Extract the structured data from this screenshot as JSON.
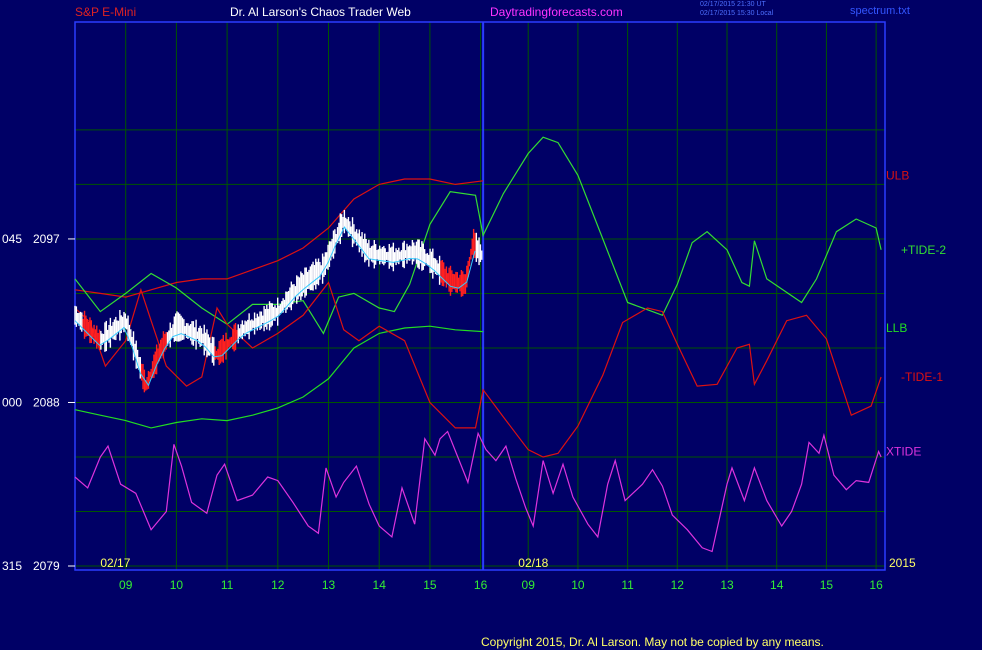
{
  "header": {
    "symbol": "S&P E-Mini",
    "title": "Dr. Al Larson's Chaos Trader Web",
    "site": "Daytradingforecasts.com",
    "stamp_ut": "02/17/2015 21:30 UT",
    "stamp_local": "02/17/2015 15:30 Local",
    "file": "spectrum.txt"
  },
  "copyright": "Copyright 2015, Dr. Al Larson. May not be copied by any means.",
  "colors": {
    "background": "#000066",
    "plot_border": "#2a3cff",
    "grid": "#005500",
    "ulb": "#dd1111",
    "llb": "#22dd22",
    "tide_plus": "#33dd33",
    "tide_minus": "#dd1111",
    "xtide": "#dd33dd",
    "ma": "#33ccff",
    "price_up": "#ffffff",
    "price_down": "#ff2020",
    "title_red": "#dd2222",
    "title_white": "#ffffff",
    "title_magenta": "#ff33ff",
    "label_yellow": "#ffff66",
    "label_green": "#33ee33"
  },
  "chart_data": {
    "type": "line",
    "ylabels": [
      {
        "left": "045",
        "price": "2097",
        "value": 2097
      },
      {
        "left": "000",
        "price": "2088",
        "value": 2088
      },
      {
        "left": "315",
        "price": "2079",
        "value": 2079
      }
    ],
    "ylim": [
      2079,
      2104
    ],
    "xlim": [
      8.0,
      32.1
    ],
    "date_labels": [
      {
        "text": "02/17",
        "x": 8.5
      },
      {
        "text": "02/18",
        "x": 16.8
      }
    ],
    "year_label": "2015",
    "xticks": [
      {
        "label": "09",
        "x": 9
      },
      {
        "label": "10",
        "x": 10
      },
      {
        "label": "11",
        "x": 11
      },
      {
        "label": "12",
        "x": 12
      },
      {
        "label": "13",
        "x": 13
      },
      {
        "label": "14",
        "x": 14
      },
      {
        "label": "15",
        "x": 15
      },
      {
        "label": "16",
        "x": 16
      },
      {
        "label": "09",
        "x": 17
      },
      {
        "label": "10",
        "x": 18
      },
      {
        "label": "11",
        "x": 19
      },
      {
        "label": "12",
        "x": 20
      },
      {
        "label": "13",
        "x": 21
      },
      {
        "label": "14",
        "x": 22
      },
      {
        "label": "15",
        "x": 23
      },
      {
        "label": "16",
        "x": 24
      }
    ],
    "now_x": 16.05,
    "series": [
      {
        "name": "ULB",
        "label_value": 2100.5,
        "points": [
          [
            8.0,
            2094.2
          ],
          [
            8.5,
            2094.0
          ],
          [
            9.0,
            2093.8
          ],
          [
            9.5,
            2094.2
          ],
          [
            10.0,
            2094.6
          ],
          [
            10.5,
            2094.8
          ],
          [
            11.0,
            2094.8
          ],
          [
            11.5,
            2095.3
          ],
          [
            12.0,
            2095.8
          ],
          [
            12.5,
            2096.5
          ],
          [
            13.0,
            2097.6
          ],
          [
            13.5,
            2099.2
          ],
          [
            14.0,
            2100.0
          ],
          [
            14.5,
            2100.3
          ],
          [
            15.0,
            2100.3
          ],
          [
            15.5,
            2100.0
          ],
          [
            16.05,
            2100.2
          ]
        ]
      },
      {
        "name": "LLB",
        "label_value": 2092.1,
        "points": [
          [
            8.0,
            2087.6
          ],
          [
            8.5,
            2087.3
          ],
          [
            9.0,
            2087.0
          ],
          [
            9.5,
            2086.6
          ],
          [
            10.0,
            2086.9
          ],
          [
            10.5,
            2087.1
          ],
          [
            11.0,
            2087.0
          ],
          [
            11.5,
            2087.3
          ],
          [
            12.0,
            2087.7
          ],
          [
            12.5,
            2088.3
          ],
          [
            13.0,
            2089.3
          ],
          [
            13.5,
            2091.0
          ],
          [
            14.0,
            2091.8
          ],
          [
            14.5,
            2092.1
          ],
          [
            15.0,
            2092.2
          ],
          [
            15.5,
            2092.0
          ],
          [
            16.05,
            2091.9
          ]
        ]
      },
      {
        "name": "+TIDE-2",
        "label_value": 2096.4,
        "points": [
          [
            8.0,
            2094.8
          ],
          [
            8.5,
            2093.0
          ],
          [
            9.0,
            2094.0
          ],
          [
            9.5,
            2095.1
          ],
          [
            10.0,
            2094.3
          ],
          [
            10.5,
            2093.2
          ],
          [
            11.0,
            2092.3
          ],
          [
            11.5,
            2093.4
          ],
          [
            12.0,
            2093.4
          ],
          [
            12.5,
            2093.6
          ],
          [
            12.9,
            2091.8
          ],
          [
            13.2,
            2093.8
          ],
          [
            13.5,
            2094.0
          ],
          [
            14.0,
            2093.2
          ],
          [
            14.3,
            2093.0
          ],
          [
            14.6,
            2094.5
          ],
          [
            15.0,
            2097.8
          ],
          [
            15.4,
            2099.6
          ],
          [
            15.9,
            2099.4
          ],
          [
            16.05,
            2097.2
          ],
          [
            16.5,
            2099.5
          ],
          [
            17.0,
            2101.7
          ],
          [
            17.3,
            2102.6
          ],
          [
            17.6,
            2102.3
          ],
          [
            18.0,
            2100.5
          ],
          [
            18.5,
            2097.0
          ],
          [
            19.0,
            2093.5
          ],
          [
            19.5,
            2093.0
          ],
          [
            19.7,
            2092.8
          ],
          [
            20.0,
            2094.5
          ],
          [
            20.3,
            2096.8
          ],
          [
            20.6,
            2097.4
          ],
          [
            21.0,
            2096.4
          ],
          [
            21.3,
            2094.6
          ],
          [
            21.45,
            2094.4
          ],
          [
            21.55,
            2096.9
          ],
          [
            21.8,
            2094.8
          ],
          [
            22.5,
            2093.5
          ],
          [
            22.8,
            2094.8
          ],
          [
            23.2,
            2097.4
          ],
          [
            23.6,
            2098.1
          ],
          [
            24.0,
            2097.6
          ],
          [
            24.1,
            2096.4
          ]
        ]
      },
      {
        "name": "-TIDE-1",
        "label_value": 2089.4,
        "points": [
          [
            8.0,
            2093.2
          ],
          [
            8.3,
            2092.4
          ],
          [
            8.6,
            2090.0
          ],
          [
            9.0,
            2091.4
          ],
          [
            9.3,
            2094.2
          ],
          [
            9.5,
            2092.5
          ],
          [
            9.8,
            2090.0
          ],
          [
            10.2,
            2088.9
          ],
          [
            10.5,
            2089.4
          ],
          [
            10.8,
            2093.2
          ],
          [
            11.0,
            2092.3
          ],
          [
            11.5,
            2091.0
          ],
          [
            12.0,
            2091.8
          ],
          [
            12.5,
            2092.8
          ],
          [
            13.0,
            2094.6
          ],
          [
            13.3,
            2092.0
          ],
          [
            13.6,
            2091.4
          ],
          [
            14.0,
            2092.2
          ],
          [
            14.5,
            2091.4
          ],
          [
            15.0,
            2088.0
          ],
          [
            15.5,
            2086.6
          ],
          [
            15.9,
            2086.6
          ],
          [
            16.05,
            2088.7
          ],
          [
            16.5,
            2087.2
          ],
          [
            17.0,
            2085.4
          ],
          [
            17.3,
            2085.0
          ],
          [
            17.6,
            2085.2
          ],
          [
            18.0,
            2086.7
          ],
          [
            18.5,
            2089.5
          ],
          [
            18.9,
            2092.4
          ],
          [
            19.4,
            2093.2
          ],
          [
            19.7,
            2093.0
          ],
          [
            20.0,
            2091.2
          ],
          [
            20.4,
            2088.9
          ],
          [
            20.8,
            2089.0
          ],
          [
            21.2,
            2091.0
          ],
          [
            21.45,
            2091.2
          ],
          [
            21.55,
            2089.0
          ],
          [
            21.8,
            2090.3
          ],
          [
            22.2,
            2092.5
          ],
          [
            22.6,
            2092.8
          ],
          [
            23.0,
            2091.5
          ],
          [
            23.5,
            2087.3
          ],
          [
            23.9,
            2087.8
          ],
          [
            24.1,
            2089.4
          ]
        ]
      },
      {
        "name": "XTIDE",
        "label_value": 2085.3,
        "points": [
          [
            8.0,
            2083.9
          ],
          [
            8.25,
            2083.3
          ],
          [
            8.5,
            2085.0
          ],
          [
            8.65,
            2085.6
          ],
          [
            8.9,
            2083.5
          ],
          [
            9.2,
            2083.0
          ],
          [
            9.5,
            2081.0
          ],
          [
            9.8,
            2082.0
          ],
          [
            9.95,
            2085.7
          ],
          [
            10.1,
            2084.5
          ],
          [
            10.3,
            2082.5
          ],
          [
            10.6,
            2081.9
          ],
          [
            10.8,
            2084.0
          ],
          [
            10.95,
            2084.6
          ],
          [
            11.2,
            2082.6
          ],
          [
            11.5,
            2082.9
          ],
          [
            11.8,
            2083.9
          ],
          [
            12.0,
            2083.7
          ],
          [
            12.3,
            2082.5
          ],
          [
            12.6,
            2081.2
          ],
          [
            12.8,
            2080.8
          ],
          [
            12.95,
            2084.4
          ],
          [
            13.15,
            2082.8
          ],
          [
            13.3,
            2083.6
          ],
          [
            13.55,
            2084.5
          ],
          [
            13.8,
            2082.4
          ],
          [
            14.0,
            2081.2
          ],
          [
            14.25,
            2080.6
          ],
          [
            14.45,
            2083.3
          ],
          [
            14.7,
            2081.3
          ],
          [
            14.9,
            2086.0
          ],
          [
            15.1,
            2085.1
          ],
          [
            15.2,
            2086.0
          ],
          [
            15.35,
            2086.4
          ],
          [
            15.55,
            2085.0
          ],
          [
            15.75,
            2083.6
          ],
          [
            15.95,
            2086.3
          ],
          [
            16.15,
            2085.4
          ],
          [
            16.35,
            2084.8
          ],
          [
            16.55,
            2085.6
          ],
          [
            16.75,
            2083.8
          ],
          [
            16.95,
            2082.2
          ],
          [
            17.1,
            2081.2
          ],
          [
            17.3,
            2084.8
          ],
          [
            17.5,
            2083.0
          ],
          [
            17.7,
            2084.6
          ],
          [
            17.9,
            2082.8
          ],
          [
            18.2,
            2081.3
          ],
          [
            18.4,
            2080.6
          ],
          [
            18.6,
            2083.5
          ],
          [
            18.75,
            2084.8
          ],
          [
            18.95,
            2082.6
          ],
          [
            19.3,
            2083.5
          ],
          [
            19.5,
            2084.3
          ],
          [
            19.7,
            2083.4
          ],
          [
            19.9,
            2081.8
          ],
          [
            20.2,
            2081.0
          ],
          [
            20.5,
            2080.0
          ],
          [
            20.7,
            2079.8
          ],
          [
            21.0,
            2083.5
          ],
          [
            21.1,
            2084.4
          ],
          [
            21.35,
            2082.6
          ],
          [
            21.55,
            2084.4
          ],
          [
            21.8,
            2082.6
          ],
          [
            22.1,
            2081.2
          ],
          [
            22.3,
            2082.0
          ],
          [
            22.5,
            2083.5
          ],
          [
            22.65,
            2085.8
          ],
          [
            22.85,
            2085.2
          ],
          [
            22.95,
            2086.2
          ],
          [
            23.15,
            2084.0
          ],
          [
            23.4,
            2083.2
          ],
          [
            23.6,
            2083.7
          ],
          [
            23.85,
            2083.6
          ],
          [
            24.05,
            2085.3
          ],
          [
            24.1,
            2085.0
          ]
        ]
      }
    ]
  }
}
